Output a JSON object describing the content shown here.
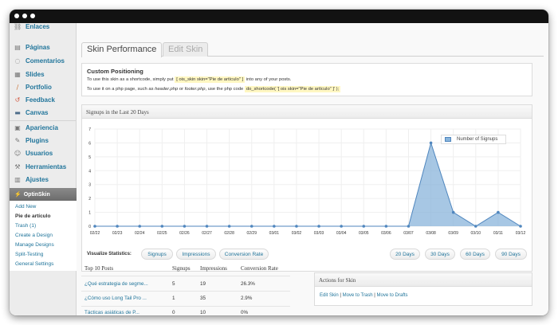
{
  "sidebar": {
    "items": [
      {
        "label": "Enlaces",
        "icon": "link-icon"
      },
      {
        "label": "Páginas",
        "icon": "pages-icon"
      },
      {
        "label": "Comentarios",
        "icon": "comments-icon"
      },
      {
        "label": "Slides",
        "icon": "slides-icon"
      },
      {
        "label": "Portfolio",
        "icon": "portfolio-icon"
      },
      {
        "label": "Feedback",
        "icon": "feedback-icon"
      },
      {
        "label": "Canvas",
        "icon": "canvas-icon"
      },
      {
        "label": "Apariencia",
        "icon": "appearance-icon"
      },
      {
        "label": "Plugins",
        "icon": "plugins-icon"
      },
      {
        "label": "Usuarios",
        "icon": "users-icon"
      },
      {
        "label": "Herramientas",
        "icon": "tools-icon"
      },
      {
        "label": "Ajustes",
        "icon": "settings-icon"
      }
    ],
    "optin": {
      "label": "OptinSkin",
      "submenu": [
        "Add New",
        "Pie de artículo",
        "Trash (1)",
        "Create a Design",
        "Manage Designs",
        "Split-Testing",
        "General Settings"
      ]
    }
  },
  "tabs": {
    "active": "Skin Performance",
    "inactive": "Edit Skin"
  },
  "custom_positioning": {
    "title": "Custom Positioning",
    "line1_pre": "To use this skin as a shortcode, simply put",
    "line1_code": "[ ois_skin skin=\"Pie de artículo\" ]",
    "line1_post": "into any of your posts.",
    "line2_pre": "To use it on a php page, such as",
    "line2_file1": "header.php",
    "line2_or": "or",
    "line2_file2": "footer.php",
    "line2_mid": ", use the php code",
    "line2_code": "do_shortcode( '[ ois skin=\"Pie de artículo\" ]' );"
  },
  "signups": {
    "title": "Signups in the Last 20 Days",
    "visualize_label": "Visualize Statistics:",
    "stat_buttons": [
      "Signups",
      "Impressions",
      "Conversion Rate"
    ],
    "range_buttons": [
      "20 Days",
      "30 Days",
      "60 Days",
      "90 Days"
    ]
  },
  "chart_data": {
    "type": "area",
    "x": [
      "02/22",
      "02/23",
      "02/24",
      "02/25",
      "02/26",
      "02/27",
      "02/28",
      "02/29",
      "03/01",
      "03/02",
      "03/03",
      "03/04",
      "03/05",
      "03/06",
      "03/07",
      "03/08",
      "03/09",
      "03/10",
      "03/11",
      "03/12"
    ],
    "series": [
      {
        "name": "Number of Signups",
        "values": [
          0,
          0,
          0,
          0,
          0,
          0,
          0,
          0,
          0,
          0,
          0,
          0,
          0,
          0,
          0,
          6,
          1,
          0,
          1,
          0
        ],
        "color": "#89b4db",
        "line_color": "#4f86be"
      }
    ],
    "y_ticks": [
      "0",
      "1",
      "2",
      "3",
      "4",
      "5",
      "6",
      "7"
    ],
    "ylim": [
      0,
      7
    ],
    "grid": true,
    "legend_position": "top-right"
  },
  "top_posts": {
    "headers": [
      "Top 10 Posts",
      "Signups",
      "Impressions",
      "Conversion Rate"
    ],
    "rows": [
      [
        "¿Qué estrategia de segme...",
        "5",
        "19",
        "26.3%"
      ],
      [
        "¿Cómo uso Long Tail Pro ...",
        "1",
        "35",
        "2.9%"
      ],
      [
        "Tácticas asiáticas de P...",
        "0",
        "10",
        "0%"
      ]
    ]
  },
  "actions": {
    "title": "Actions for Skin",
    "edit": "Edit Skin",
    "sep": "|",
    "trash": "Move to Trash",
    "drafts": "Move to Drafts"
  }
}
